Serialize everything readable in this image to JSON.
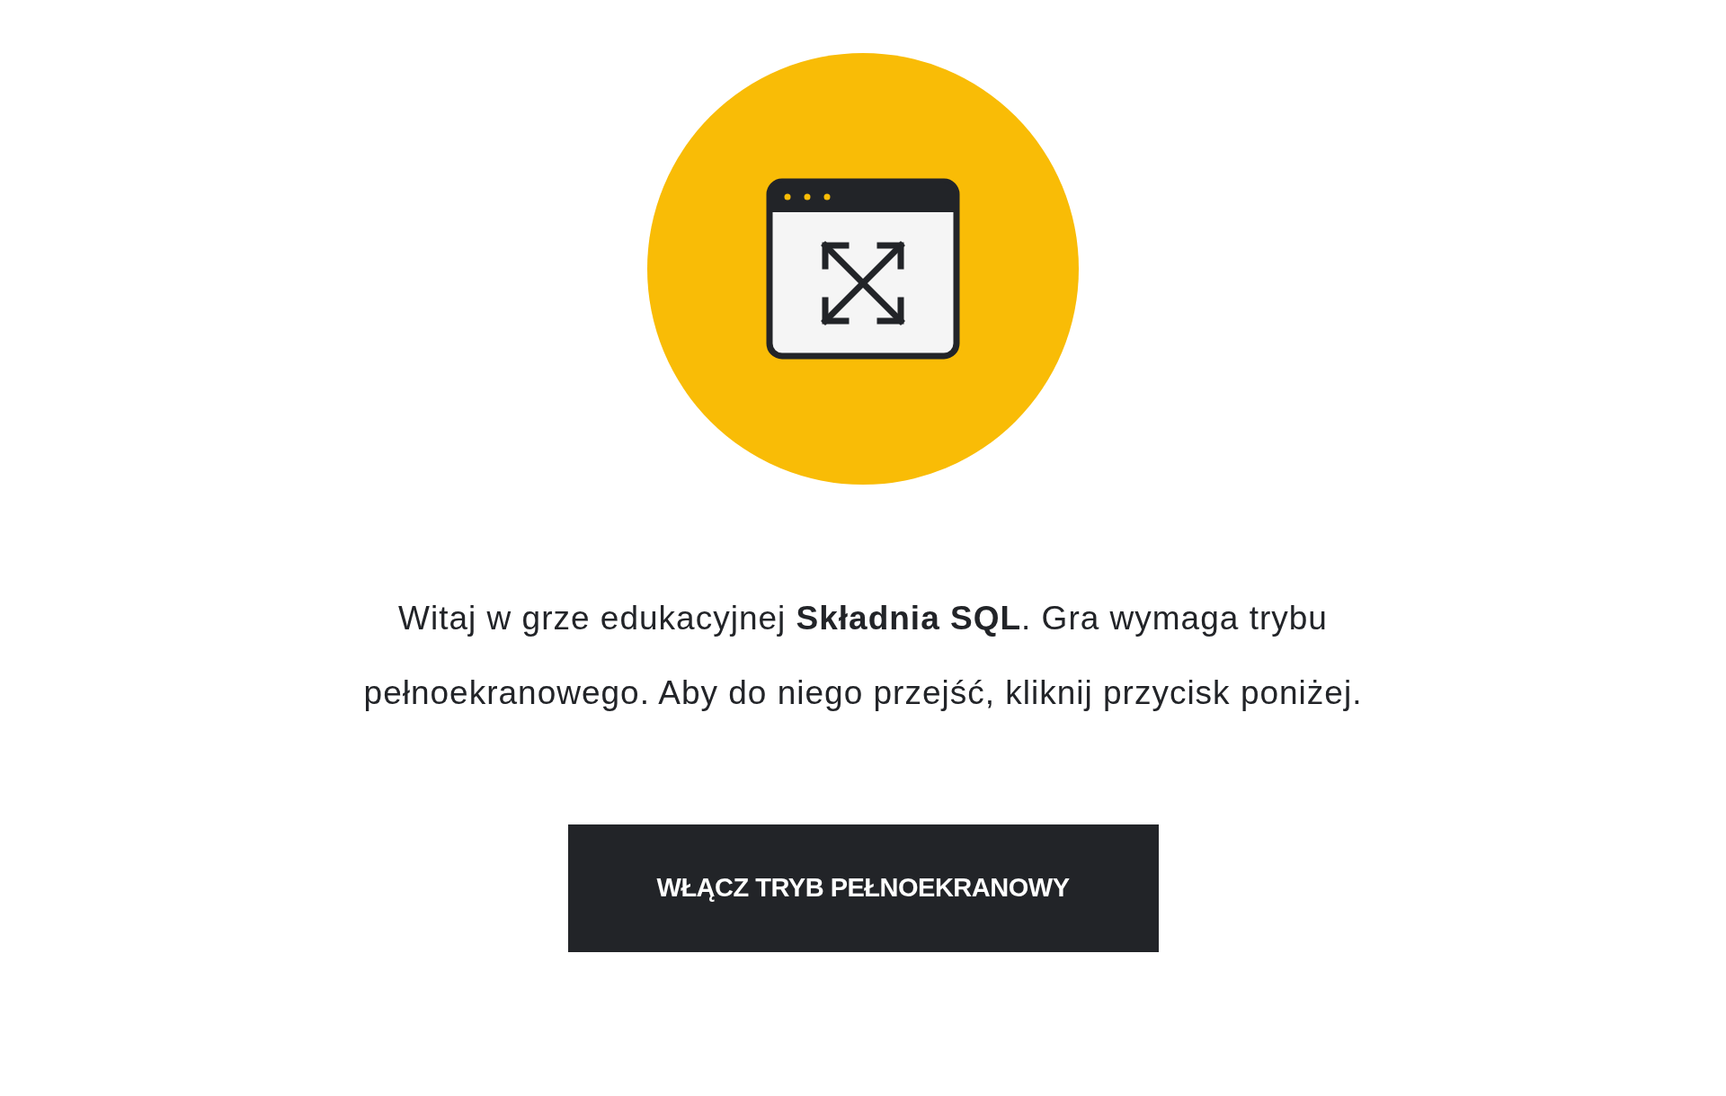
{
  "intro": "Witaj w grze edukacyjnej **Składnia SQL**. Gra wymaga trybu pełnoekranowego. Aby do niego przejść, kliknij przycisk poniżej.",
  "button": {
    "label": "WŁĄCZ TRYB PEŁNOEKRANOWY"
  }
}
